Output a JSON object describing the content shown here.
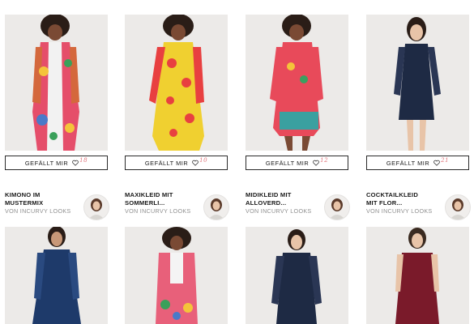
{
  "products": [
    {
      "like_label": "GEFÄLLT MIR",
      "count": "18",
      "title_line1": "KIMONO IM",
      "title_line2": "MUSTERMIX",
      "subtitle": "VON INCURVY LOOKS",
      "icon": "heart-icon"
    },
    {
      "like_label": "GEFÄLLT MIR",
      "count": "10",
      "title_line1": "MAXIKLEID MIT",
      "title_line2": "SOMMERLI...",
      "subtitle": "VON INCURVY LOOKS",
      "icon": "heart-icon"
    },
    {
      "like_label": "GEFÄLLT MIR",
      "count": "12",
      "title_line1": "MIDIKLEID MIT",
      "title_line2": "ALLOVERD...",
      "subtitle": "VON INCURVY LOOKS",
      "icon": "heart-icon"
    },
    {
      "like_label": "GEFÄLLT MIR",
      "count": "21",
      "title_line1": "COCKTAILKLEID",
      "title_line2": "MIT FLOR...",
      "subtitle": "VON INCURVY LOOKS",
      "icon": "heart-icon"
    }
  ],
  "colors": {
    "accent_count": "#e0737a",
    "photo_background": "#eceae8",
    "subtitle": "#8f8f8f"
  }
}
